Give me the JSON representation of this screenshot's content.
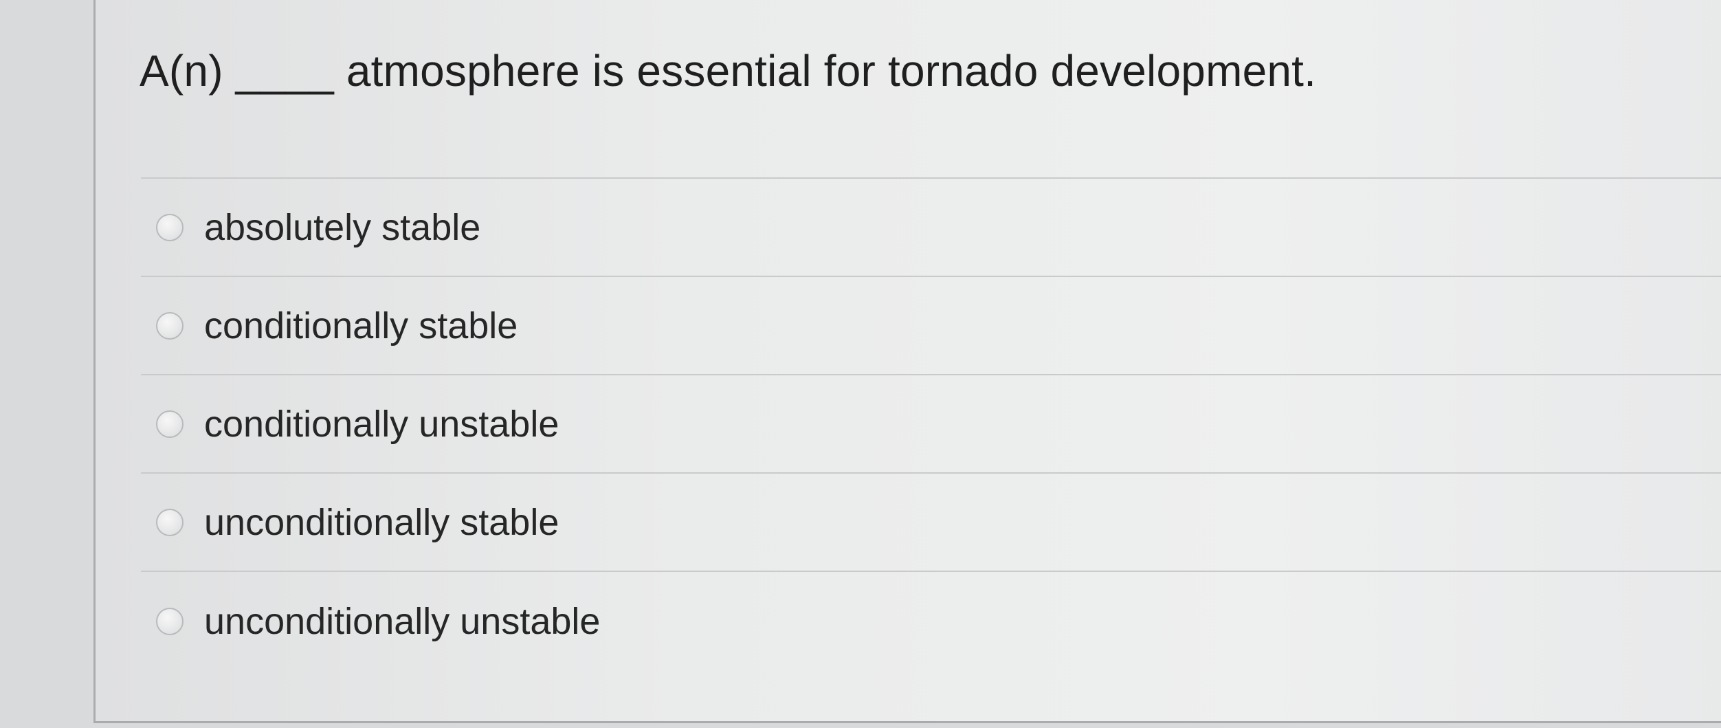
{
  "question": {
    "text": "A(n) ____ atmosphere is essential for tornado development."
  },
  "options": [
    {
      "label": "absolutely stable",
      "selected": false
    },
    {
      "label": "conditionally stable",
      "selected": false
    },
    {
      "label": "conditionally unstable",
      "selected": false
    },
    {
      "label": "unconditionally stable",
      "selected": false
    },
    {
      "label": "unconditionally unstable",
      "selected": false
    }
  ]
}
